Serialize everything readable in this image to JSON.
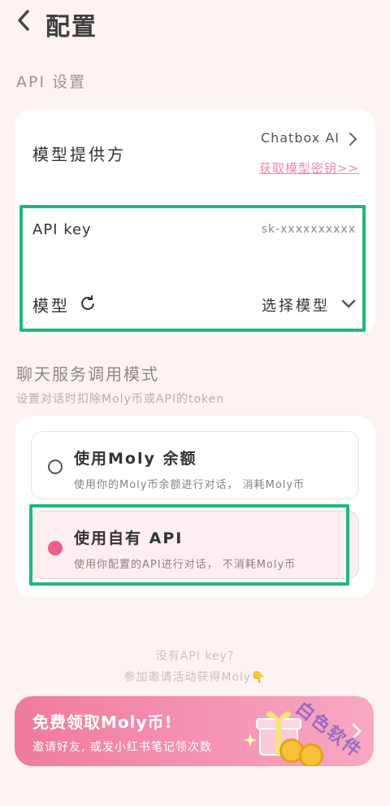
{
  "header": {
    "back_icon": "chevron-left-icon",
    "title": "配置"
  },
  "api_settings": {
    "section_title": "API 设置",
    "provider_label": "模型提供方",
    "provider_value": "Chatbox AI",
    "get_key_link": "获取模型密钥>>",
    "api_key_label": "API key",
    "api_key_value": "sk-xxxxxxxxxx",
    "model_label": "模型",
    "model_value": "选择模型"
  },
  "chat_mode": {
    "section_title": "聊天服务调用模式",
    "section_subtitle": "设置对话时扣除Moly币或API的token",
    "options": [
      {
        "title": "使用Moly 余额",
        "desc": "使用你的Moly币余额进行对话， 消耗Moly币",
        "selected": false
      },
      {
        "title": "使用自有 API",
        "desc": "使用你配置的API进行对话， 不消耗Moly币",
        "selected": true
      }
    ]
  },
  "hint": {
    "line1": "没有API key?",
    "line2": "参加邀请活动获得Moly👇"
  },
  "banner": {
    "title": "免费领取Moly币!",
    "subtitle": "邀请好友, 或发小红书笔记领次数",
    "watermark": "白色软件"
  },
  "colors": {
    "accent": "#ef5d8a",
    "highlight": "#1fb879",
    "background": "#fdf3f2"
  }
}
